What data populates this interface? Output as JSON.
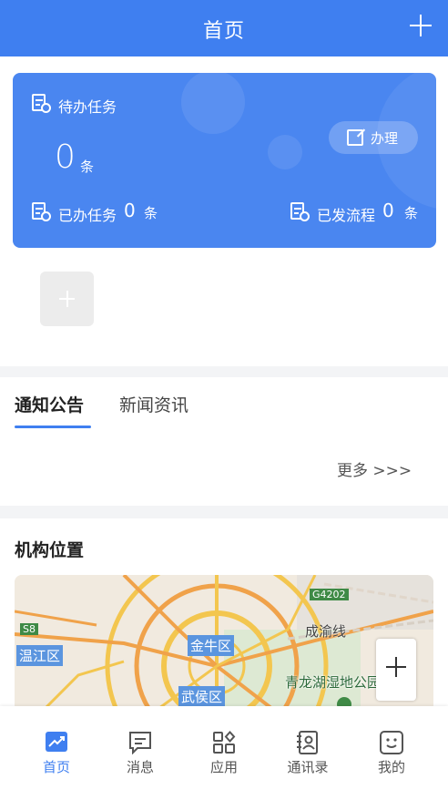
{
  "header": {
    "title": "首页"
  },
  "task_card": {
    "pending_label": "待办任务",
    "pending_count": "0",
    "pending_unit": "条",
    "handle_button": "办理",
    "done_label": "已办任务",
    "done_count": "0",
    "done_unit": "条",
    "sent_label": "已发流程",
    "sent_count": "0",
    "sent_unit": "条"
  },
  "notice": {
    "tabs": [
      "通知公告",
      "新闻资讯"
    ],
    "more": "更多 >>>"
  },
  "location": {
    "title": "机构位置",
    "map_labels": {
      "wenjiang": "温江区",
      "jinniu": "金牛区",
      "wuhou": "武侯区",
      "chengyu": "成渝线",
      "qinglonghu": "青龙湖湿地公园",
      "g4202": "G4202",
      "s8": "S8"
    }
  },
  "tabbar": {
    "items": [
      {
        "label": "首页",
        "icon": "chart-trend-icon",
        "active": true
      },
      {
        "label": "消息",
        "icon": "message-icon"
      },
      {
        "label": "应用",
        "icon": "apps-grid-icon"
      },
      {
        "label": "通讯录",
        "icon": "contacts-book-icon"
      },
      {
        "label": "我的",
        "icon": "smiley-icon"
      }
    ]
  },
  "colors": {
    "primary": "#3f7ff0",
    "card": "#4a86f0"
  }
}
